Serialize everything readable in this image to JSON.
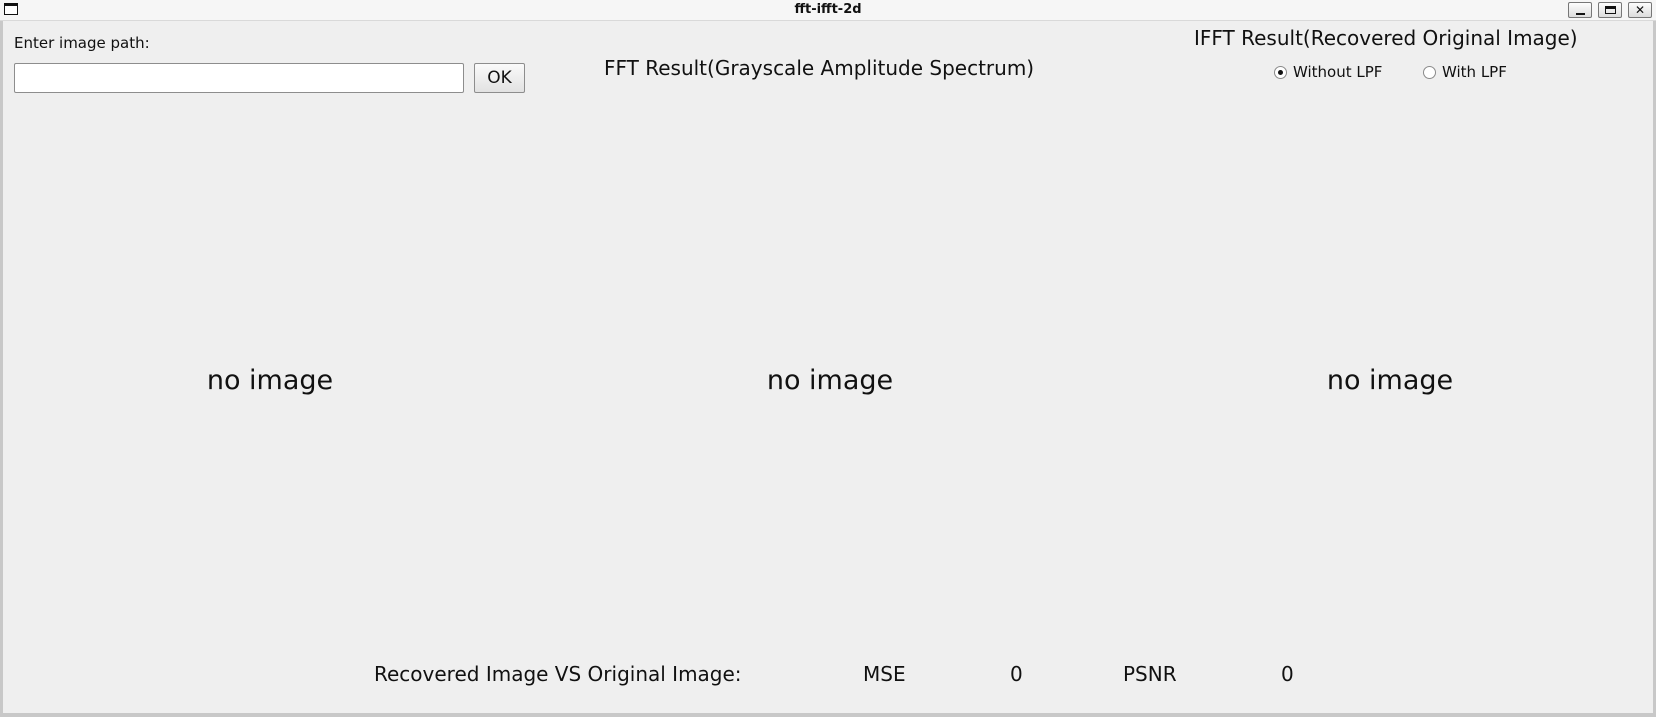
{
  "window": {
    "title": "fft-ifft-2d"
  },
  "input_section": {
    "label": "Enter image path:",
    "path_value": "",
    "path_placeholder": "",
    "ok_label": "OK"
  },
  "fft_panel": {
    "heading": "FFT Result(Grayscale Amplitude Spectrum)",
    "placeholder": "no image"
  },
  "original_panel": {
    "placeholder": "no image"
  },
  "ifft_panel": {
    "heading": "IFFT Result(Recovered Original Image)",
    "placeholder": "no image",
    "radio_options": [
      {
        "label": "Without LPF",
        "checked": true
      },
      {
        "label": "With LPF",
        "checked": false
      }
    ]
  },
  "metrics": {
    "label": "Recovered Image VS Original Image:",
    "mse_label": "MSE",
    "mse_value": "0",
    "psnr_label": "PSNR",
    "psnr_value": "0"
  },
  "icons": {
    "app": "window-icon",
    "minimize": "minimize-icon",
    "maximize": "maximize-icon",
    "close": "close-icon"
  }
}
